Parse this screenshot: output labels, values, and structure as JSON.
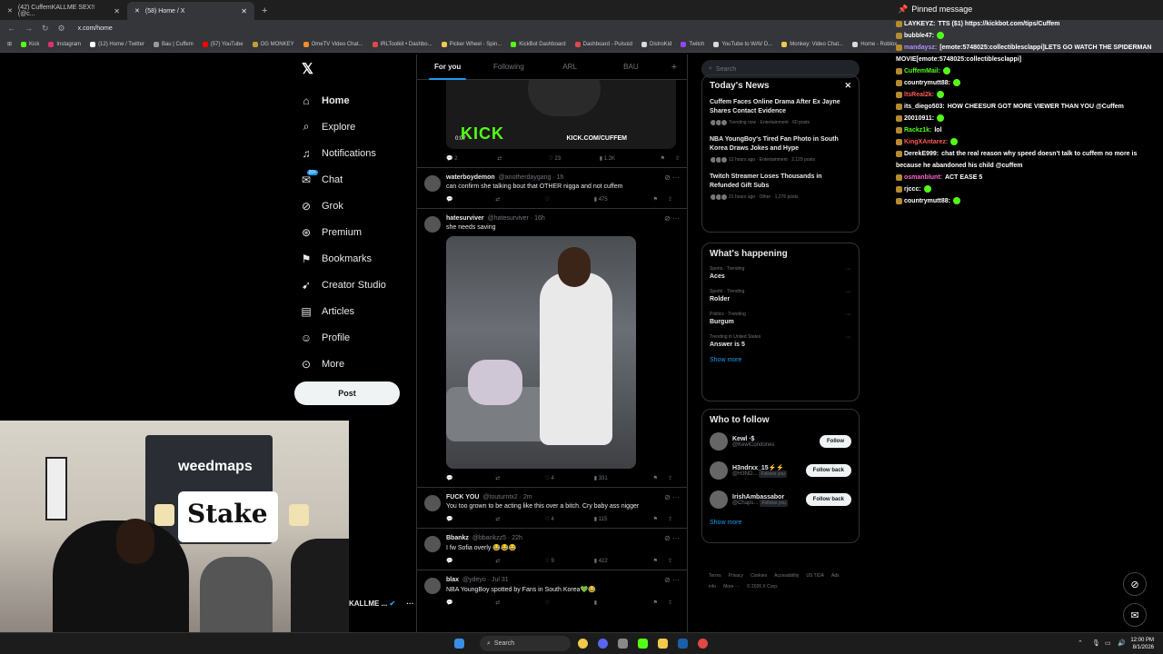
{
  "browser": {
    "tabs": [
      {
        "title": "(42) CuffemKALLME SEX!! (@c...",
        "active": false
      },
      {
        "title": "(58) Home / X",
        "active": true
      }
    ],
    "url": "x.com/home",
    "bookmarks": [
      {
        "label": "Kick",
        "color": "#53fc18"
      },
      {
        "label": "Instagram",
        "color": "#e1306c"
      },
      {
        "label": "(12) Home / Twitter",
        "color": "#ffffff"
      },
      {
        "label": "Bau | Cuffem",
        "color": "#999999"
      },
      {
        "label": "(57) YouTube",
        "color": "#ff0000"
      },
      {
        "label": "OG MONKEY",
        "color": "#c49a3a"
      },
      {
        "label": "OmeTV Video Chat...",
        "color": "#f28c28"
      },
      {
        "label": "IRLToolkit • Dashbo...",
        "color": "#e04848"
      },
      {
        "label": "Picker Wheel - Spin...",
        "color": "#f2c94c"
      },
      {
        "label": "KickBot Dashboard",
        "color": "#53fc18"
      },
      {
        "label": "Dashboard - Pulsoid",
        "color": "#e04848"
      },
      {
        "label": "DistroKid",
        "color": "#d9d9d9"
      },
      {
        "label": "Twitch",
        "color": "#9146ff"
      },
      {
        "label": "YouTube to WAV D...",
        "color": "#d9d9d9"
      },
      {
        "label": "Monkey: Video Chat...",
        "color": "#f2c94c"
      },
      {
        "label": "Home - Roblox",
        "color": "#d9d9d9"
      }
    ]
  },
  "nav": {
    "items": [
      {
        "label": "Home",
        "icon": "home-icon",
        "glyph": "⌂"
      },
      {
        "label": "Explore",
        "icon": "search-icon",
        "glyph": "⌕"
      },
      {
        "label": "Notifications",
        "icon": "bell-icon",
        "glyph": "♫"
      },
      {
        "label": "Chat",
        "icon": "chat-icon",
        "glyph": "✉"
      },
      {
        "label": "Grok",
        "icon": "grok-icon",
        "glyph": "⊘"
      },
      {
        "label": "Premium",
        "icon": "premium-icon",
        "glyph": "⊛"
      },
      {
        "label": "Bookmarks",
        "icon": "bookmark-icon",
        "glyph": "⚑"
      },
      {
        "label": "Creator Studio",
        "icon": "rocket-icon",
        "glyph": "➹"
      },
      {
        "label": "Articles",
        "icon": "article-icon",
        "glyph": "▤"
      },
      {
        "label": "Profile",
        "icon": "profile-icon",
        "glyph": "☺"
      },
      {
        "label": "More",
        "icon": "more-icon",
        "glyph": "⊙"
      }
    ],
    "chat_badge": "20+",
    "post_label": "Post",
    "account_name": "KALLME ..."
  },
  "feed": {
    "tabs": [
      "For you",
      "Following",
      "ARL",
      "BAU"
    ],
    "video": {
      "brand": "KICK",
      "url": "KICK.COM/CUFFEM",
      "time": "0:07"
    },
    "video_stats": {
      "replies": "2",
      "likes": "23",
      "views": "1.2K"
    },
    "tweets": [
      {
        "name": "waterboydemon",
        "handle": "@anotherdaygang · 1h",
        "text": "can confirm she talking bout that OTHER nigga and not cuffem",
        "replies": "",
        "likes": "",
        "views": "475"
      },
      {
        "name": "hatesurviver",
        "handle": "@hatesurviver · 16h",
        "text": "she needs saving",
        "replies": "",
        "likes": "4",
        "views": "331"
      },
      {
        "name": "FUCK YOU",
        "handle": "@touturntx2 · 2m",
        "text": "You too grown to be acting like this over a bitch. Cry baby ass nigger",
        "replies": "",
        "likes": "4",
        "views": "115"
      },
      {
        "name": "Bbankz",
        "handle": "@bbankzz5 · 22h",
        "text": "I fw Sofia overly 😂😂😂",
        "replies": "",
        "likes": "9",
        "views": "422"
      },
      {
        "name": "blax",
        "handle": "@ydeyo · Jul 31",
        "text": "NBA YoungBoy spotted by Fans in South Korea💚😂",
        "replies": "",
        "likes": "",
        "views": ""
      }
    ]
  },
  "right": {
    "search_placeholder": "Search",
    "news": {
      "title": "Today's News",
      "items": [
        {
          "headline": "Cuffem Faces Online Drama After Ex Jayne Shares Contact Evidence",
          "meta": "Trending now · Entertainment · 60 posts"
        },
        {
          "headline": "NBA YoungBoy's Tired Fan Photo in South Korea Draws Jokes and Hype",
          "meta": "12 hours ago · Entertainment · 2,129 posts"
        },
        {
          "headline": "Twitch Streamer Loses Thousands in Refunded Gift Subs",
          "meta": "21 hours ago · Other · 1,276 posts"
        }
      ]
    },
    "happening": {
      "title": "What's happening",
      "items": [
        {
          "meta": "Sports · Trending",
          "name": "Aces"
        },
        {
          "meta": "Sports · Trending",
          "name": "Rolder"
        },
        {
          "meta": "Politics · Trending",
          "name": "Burgum"
        },
        {
          "meta": "Trending in United States",
          "name": "Answer is 5"
        }
      ],
      "show_more": "Show more"
    },
    "who": {
      "title": "Who to follow",
      "items": [
        {
          "name": "Kewl ⋅$",
          "handle": "@KewlCondones",
          "button": "Follow",
          "follows_you": ""
        },
        {
          "name": "H3ndrxx_15⚡⚡",
          "handle": "@H3ND...",
          "button": "Follow back",
          "follows_you": "Follows you"
        },
        {
          "name": "IrishAmbassabor",
          "handle": "@Chaps...",
          "button": "Follow back",
          "follows_you": "Follows you"
        }
      ],
      "show_more": "Show more"
    },
    "footer": [
      "Terms",
      "Privacy",
      "Cookies",
      "Accessibility",
      "US TIDA",
      "Ads info",
      "More ···",
      "© 2026 X Corp."
    ]
  },
  "chat": {
    "pinned_label": "Pinned message",
    "messages": [
      {
        "user": "LAYKEYZ:",
        "color": "#ffffff",
        "text": "TTS ($1) https://kickbot.com/tips/Cuffem"
      },
      {
        "user": "bubble47:",
        "color": "#ffffff",
        "text": ""
      },
      {
        "user": "mandaysz:",
        "color": "#b48cff",
        "text": "[emote:5748025:collectiblesclappi]LETS GO WATCH THE SPIDERMAN MOVIE[emote:5748025:collectiblesclappi]"
      },
      {
        "user": "CuffemMail:",
        "color": "#53fc18",
        "text": ""
      },
      {
        "user": "countrymutt88:",
        "color": "#ffffff",
        "text": ""
      },
      {
        "user": "ltsReal2k:",
        "color": "#ff5a5a",
        "text": ""
      },
      {
        "user": "its_diego503:",
        "color": "#ffffff",
        "text": "HOW CHEESUR GOT MORE VIEWER THAN YOU @Cuffem"
      },
      {
        "user": "20010911:",
        "color": "#ffffff",
        "text": ""
      },
      {
        "user": "Rackz1k:",
        "color": "#53fc18",
        "text": "lol"
      },
      {
        "user": "KingXAntarez:",
        "color": "#ff5a5a",
        "text": ""
      },
      {
        "user": "DerekE999:",
        "color": "#ffffff",
        "text": "chat the real reason why speed doesn't talk to cuffem no more is because he abandoned his child @cuffem"
      },
      {
        "user": "osmanblunt:",
        "color": "#ff66cc",
        "text": "ACT EASE 5"
      },
      {
        "user": "rjccc:",
        "color": "#ffffff",
        "text": ""
      },
      {
        "user": "countrymutt88:",
        "color": "#ffffff",
        "text": ""
      }
    ]
  },
  "webcam": {
    "banner1": "weedmaps",
    "banner2": "Stake"
  },
  "taskbar": {
    "search_label": "Search",
    "time": "12:00 PM",
    "date": "8/1/2026"
  }
}
